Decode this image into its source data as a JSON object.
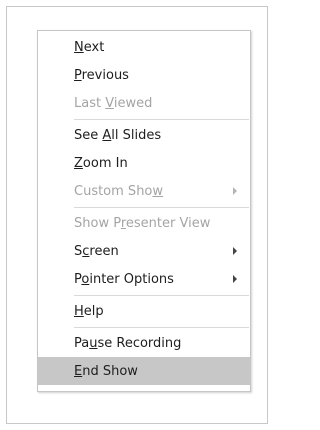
{
  "menu": {
    "items": [
      {
        "pre": "",
        "u": "N",
        "post": "ext"
      },
      {
        "pre": "",
        "u": "P",
        "post": "revious"
      },
      {
        "pre": "Last ",
        "u": "V",
        "post": "iewed"
      },
      {
        "pre": "See ",
        "u": "A",
        "post": "ll Slides"
      },
      {
        "pre": "",
        "u": "Z",
        "post": "oom In"
      },
      {
        "pre": "Custom Sho",
        "u": "w",
        "post": ""
      },
      {
        "pre": "Show P",
        "u": "r",
        "post": "esenter View"
      },
      {
        "pre": "S",
        "u": "c",
        "post": "reen"
      },
      {
        "pre": "P",
        "u": "o",
        "post": "inter Options"
      },
      {
        "pre": "",
        "u": "H",
        "post": "elp"
      },
      {
        "pre": "Pa",
        "u": "u",
        "post": "se Recording"
      },
      {
        "pre": "",
        "u": "E",
        "post": "nd Show"
      }
    ]
  }
}
